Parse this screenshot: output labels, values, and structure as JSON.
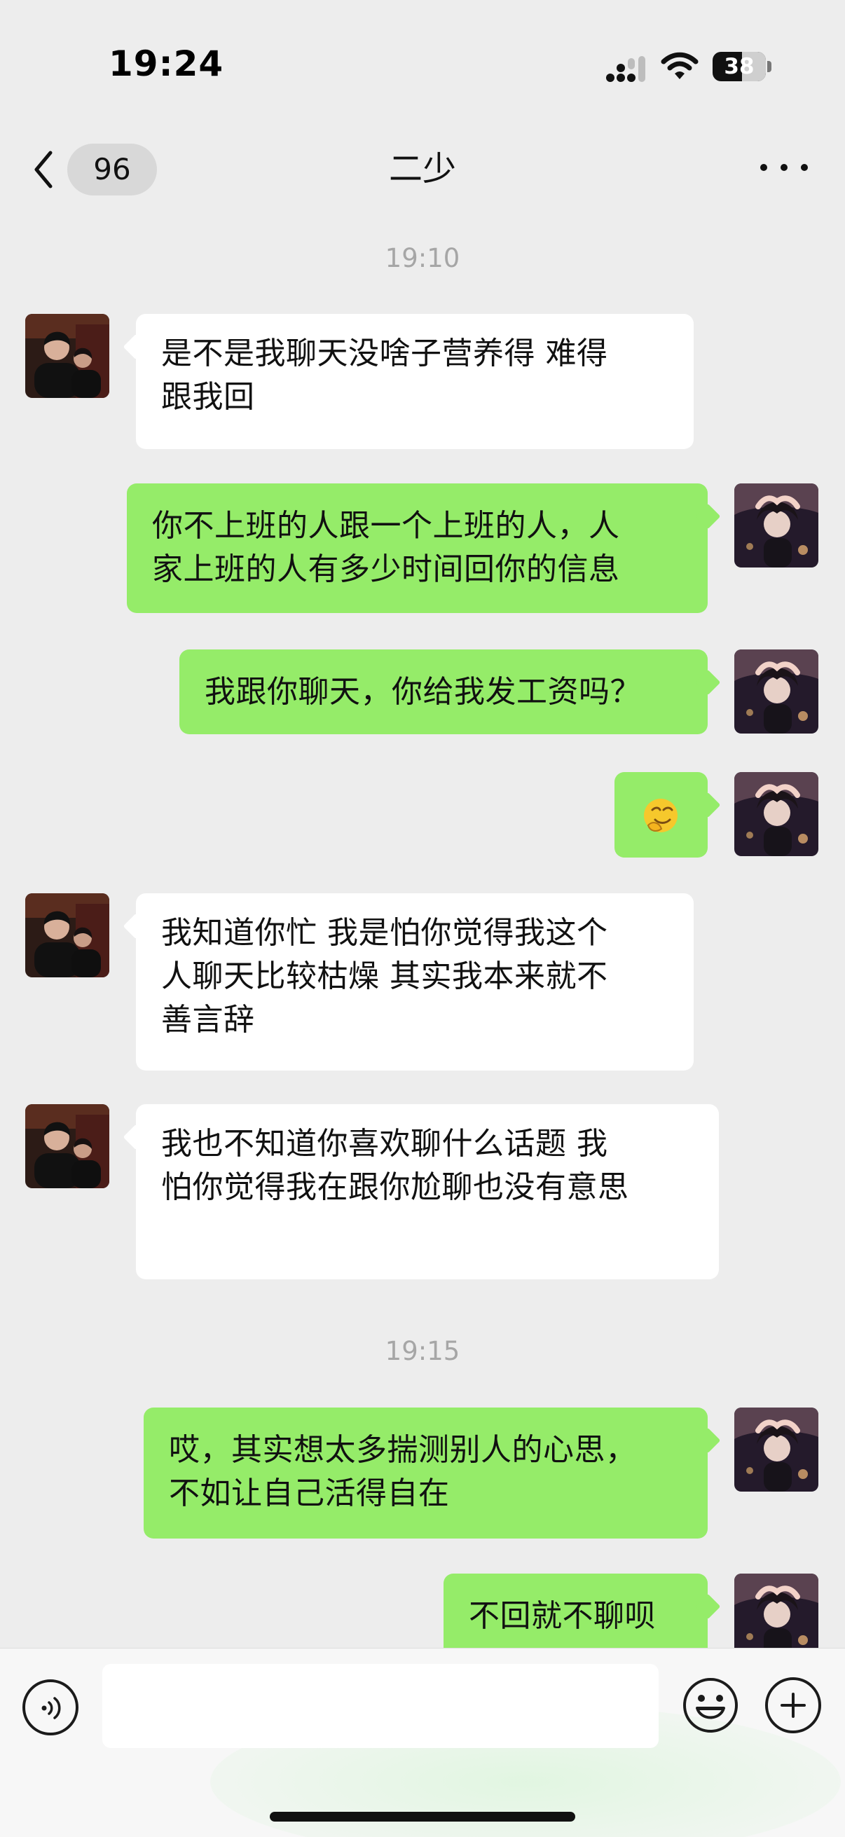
{
  "status_bar": {
    "time": "19:24",
    "battery_level": "38",
    "icons": [
      "signal-icon",
      "wifi-icon",
      "battery-icon"
    ]
  },
  "header": {
    "back_badge": "96",
    "title": "二少",
    "more_icon": "more-icon"
  },
  "messages": [
    {
      "type": "time",
      "text": "19:10"
    },
    {
      "type": "message",
      "side": "left",
      "text": "是不是我聊天没啥子营养得 难得\n跟我回"
    },
    {
      "type": "message",
      "side": "right",
      "text": "你不上班的人跟一个上班的人，人\n家上班的人有多少时间回你的信息"
    },
    {
      "type": "message",
      "side": "right",
      "text": "我跟你聊天，你给我发工资吗？"
    },
    {
      "type": "emoji",
      "side": "right",
      "emoji": "smile-emoji"
    },
    {
      "type": "message",
      "side": "left",
      "text": "我知道你忙 我是怕你觉得我这个\n人聊天比较枯燥 其实我本来就不\n善言辞"
    },
    {
      "type": "message",
      "side": "left",
      "text": "我也不知道你喜欢聊什么话题 我\n怕你觉得我在跟你尬聊也没有意思\n"
    },
    {
      "type": "time",
      "text": "19:15"
    },
    {
      "type": "message",
      "side": "right",
      "text": "哎，其实想太多揣测别人的心思，\n不如让自己活得自在"
    },
    {
      "type": "message",
      "side": "right",
      "text": "不回就不聊呗"
    }
  ],
  "input": {
    "voice_icon": "voice-icon",
    "emoji_icon": "emoji-icon",
    "plus_icon": "plus-icon",
    "value": ""
  },
  "colors": {
    "background": "#ededed",
    "incoming_bubble": "#ffffff",
    "outgoing_bubble": "#95ec69",
    "timestamp": "#a6a6a6"
  }
}
